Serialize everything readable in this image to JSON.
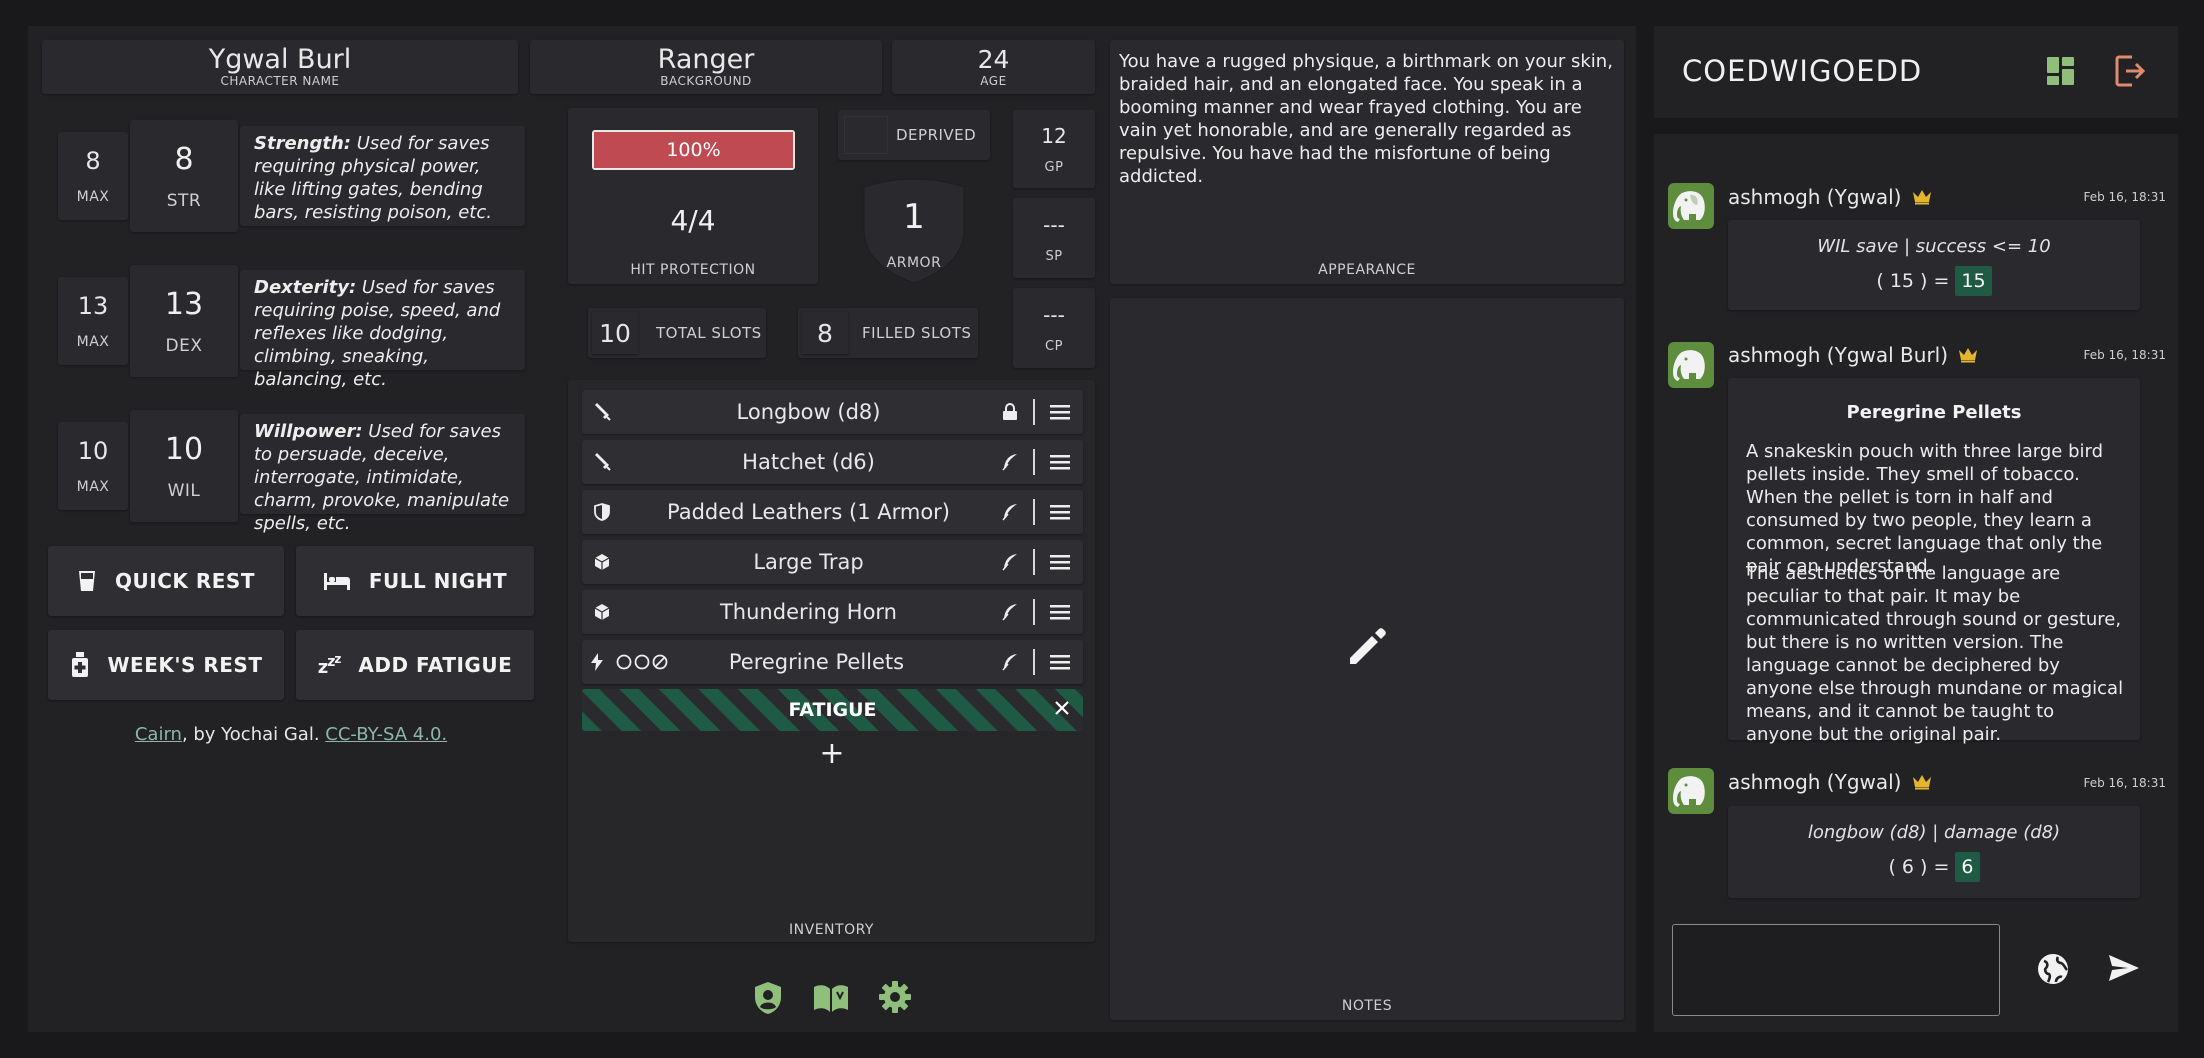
{
  "character": {
    "name": "Ygwal Burl",
    "name_caption": "CHARACTER NAME",
    "background": "Ranger",
    "background_caption": "BACKGROUND",
    "age": "24",
    "age_caption": "AGE"
  },
  "abilities": [
    {
      "max": "8",
      "max_label": "MAX",
      "value": "8",
      "label": "STR",
      "title": "Strength:",
      "text": " Used for saves requiring physical power, like lifting gates, bending bars, resisting poison, etc."
    },
    {
      "max": "13",
      "max_label": "MAX",
      "value": "13",
      "label": "DEX",
      "title": "Dexterity:",
      "text": " Used for saves requiring poise, speed, and reflexes like dodging, climbing, sneaking, balancing, etc."
    },
    {
      "max": "10",
      "max_label": "MAX",
      "value": "10",
      "label": "WIL",
      "title": "Willpower:",
      "text": " Used for saves to persuade, deceive, interrogate, intimidate, charm, provoke, manipulate spells, etc."
    }
  ],
  "hp": {
    "percent_label": "100%",
    "percent": 1.0,
    "value": "4/4",
    "caption": "HIT PROTECTION"
  },
  "deprived": {
    "label": "DEPRIVED"
  },
  "armor": {
    "value": "1",
    "caption": "ARMOR"
  },
  "money": [
    {
      "value": "12",
      "label": "GP"
    },
    {
      "value": "---",
      "label": "SP"
    },
    {
      "value": "---",
      "label": "CP"
    }
  ],
  "slots": {
    "total": "10",
    "total_label": "TOTAL SLOTS",
    "filled": "8",
    "filled_label": "FILLED SLOTS"
  },
  "buttons": {
    "quick_rest": "QUICK REST",
    "full_night": "FULL NIGHT",
    "weeks_rest": "WEEK'S REST",
    "add_fatigue": "ADD FATIGUE"
  },
  "credit": {
    "link1": "Cairn",
    "middle": ", by Yochai Gal. ",
    "link2": "CC-BY-SA 4.0."
  },
  "inventory": {
    "caption": "INVENTORY",
    "items": [
      {
        "name": "Longbow (d8)",
        "icon": "sword-icon",
        "state": "lock-icon"
      },
      {
        "name": "Hatchet (d6)",
        "icon": "sword-icon",
        "state": "feather-icon"
      },
      {
        "name": "Padded Leathers (1 Armor)",
        "icon": "shield-icon",
        "state": "feather-icon"
      },
      {
        "name": "Large Trap",
        "icon": "cube-icon",
        "state": "feather-icon"
      },
      {
        "name": "Thundering Horn",
        "icon": "cube-icon",
        "state": "feather-icon"
      },
      {
        "name": "Peregrine Pellets",
        "icon": "bolt-icon",
        "state": "feather-icon"
      }
    ],
    "fatigue": "FATIGUE",
    "add": "+"
  },
  "appearance": {
    "text": "You have a rugged physique, a birthmark on your skin, braided hair, and an elongated face. You speak in a booming manner and wear frayed clothing. You are vain yet honorable, and are generally regarded as repulsive. You have had the misfortune of being addicted.",
    "caption": "APPEARANCE"
  },
  "notes": {
    "caption": "NOTES"
  },
  "chat": {
    "title": "COEDWIGOEDD",
    "messages": [
      {
        "author": "ashmogh (Ygwal)",
        "time": "Feb 16, 18:31",
        "roll_label": "WIL save | success <= 10",
        "formula": "( 15 ) =",
        "result": "15"
      },
      {
        "author": "ashmogh (Ygwal Burl)",
        "time": "Feb 16, 18:31",
        "card_title": "Peregrine Pellets",
        "para1": "A snakeskin pouch with three large bird pellets inside. They smell of tobacco. When the pellet is torn in half and consumed by two people, they learn a common, secret language that only the pair can understand.",
        "para2": "The aesthetics of the language are peculiar to that pair. It may be communicated through sound or gesture, but there is no written version. The language cannot be deciphered by anyone else through mundane or magical means, and it cannot be taught to anyone but the original pair."
      },
      {
        "author": "ashmogh (Ygwal)",
        "time": "Feb 16, 18:31",
        "roll_label": "longbow (d8) | damage (d8)",
        "formula": "( 6 ) =",
        "result": "6"
      }
    ],
    "input_value": ""
  },
  "colors": {
    "hp_bar": "#c04a52",
    "accent_green": "#8fbf7a",
    "logout": "#e08a6e",
    "crown": "#e6b530",
    "fatigue_stripe_a": "#1f5a44",
    "fatigue_stripe_b": "#2b2b2f"
  }
}
